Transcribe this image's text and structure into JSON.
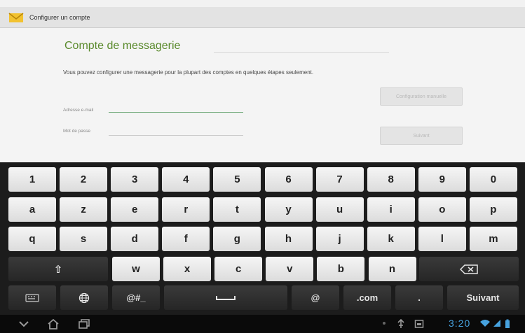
{
  "app": {
    "title": "Configurer un compte",
    "section_title": "Compte de messagerie",
    "intro": "Vous pouvez configurer une messagerie pour la plupart des comptes en quelques étapes seulement.",
    "email_label": "Adresse e-mail",
    "password_label": "Mot de passe",
    "manual_config_label": "Configuration manuelle",
    "next_label": "Suivant"
  },
  "keyboard": {
    "row1": [
      "1",
      "2",
      "3",
      "4",
      "5",
      "6",
      "7",
      "8",
      "9",
      "0"
    ],
    "row2": [
      "a",
      "z",
      "e",
      "r",
      "t",
      "y",
      "u",
      "i",
      "o",
      "p"
    ],
    "row3": [
      "q",
      "s",
      "d",
      "f",
      "g",
      "h",
      "j",
      "k",
      "l",
      "m"
    ],
    "row4": [
      "w",
      "x",
      "c",
      "v",
      "b",
      "n"
    ],
    "shift_symbol": "⇧",
    "symbols_label": "@#_",
    "at_label": "@",
    "dotcom_label": ".com",
    "dot_label": ".",
    "next_label": "Suivant"
  },
  "status": {
    "clock": "3:20"
  },
  "colors": {
    "accent_green": "#5a8a2c",
    "clock_blue": "#47a3e0"
  }
}
